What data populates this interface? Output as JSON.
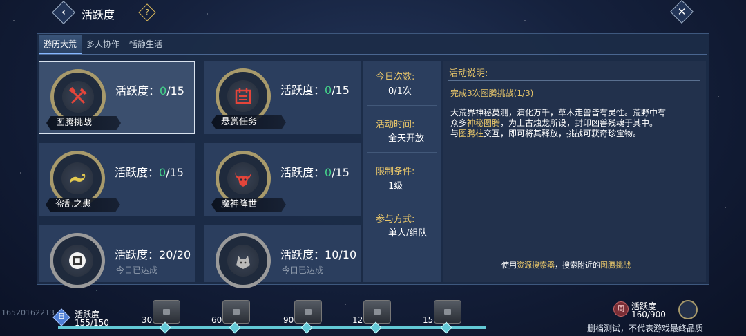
{
  "header": {
    "title": "活跃度",
    "help_icon_text": "?",
    "back_icon": "chevron-left-icon",
    "close_icon": "close-icon"
  },
  "tabs": [
    {
      "label": "游历大荒",
      "active": true
    },
    {
      "label": "多人协作",
      "active": false
    },
    {
      "label": "恬静生活",
      "active": false
    }
  ],
  "activity_label": "活跃度：",
  "cards": [
    {
      "name": "图腾挑战",
      "icon": "axe-hammer-icon",
      "current": "0",
      "max": "/15",
      "done": false,
      "note": ""
    },
    {
      "name": "悬赏任务",
      "icon": "calendar-icon",
      "current": "0",
      "max": "/15",
      "done": false,
      "note": ""
    },
    {
      "name": "盗乱之患",
      "icon": "lizard-icon",
      "current": "0",
      "max": "/15",
      "done": false,
      "note": ""
    },
    {
      "name": "魔神降世",
      "icon": "bull-skull-icon",
      "current": "0",
      "max": "/15",
      "done": false,
      "note": ""
    },
    {
      "name": "",
      "icon": "coin-icon",
      "current": "20",
      "max": "/20",
      "done": true,
      "note": "今日已达成"
    },
    {
      "name": "",
      "icon": "wolf-icon",
      "current": "10",
      "max": "/10",
      "done": true,
      "note": "今日已达成"
    }
  ],
  "info": {
    "today_count_label": "今日次数:",
    "today_count": "0/1次",
    "time_label": "活动时间:",
    "time": "全天开放",
    "limit_label": "限制条件:",
    "limit": "1级",
    "mode_label": "参与方式:",
    "mode": "单人/组队"
  },
  "description": {
    "title": "活动说明:",
    "task": "完成3次图腾挑战(1/3)",
    "line1": "大荒界神秘莫测，演化万千，草木走兽皆有灵性。荒野中有",
    "line2_a": "众多",
    "line2_hl": "神秘图腾",
    "line2_b": "，为上古烛龙所设，封印凶兽残魂于其中。",
    "line3_a": "与",
    "line3_hl": "图腾柱",
    "line3_b": "交互，即可将其释放，挑战可获奇珍宝物。",
    "foot_a": "使用",
    "foot_hl1": "资源搜索器",
    "foot_b": "，搜索附近的",
    "foot_hl2": "图腾挑战"
  },
  "bottom": {
    "uid": "16520162213",
    "day_badge": "日",
    "daily_label": "活跃度",
    "daily_count": "155/150",
    "daily_progress": 1.0,
    "milestones": [
      "30",
      "60",
      "90",
      "120",
      "150"
    ],
    "week_badge": "周",
    "weekly_label": "活跃度",
    "weekly_count": "160/900",
    "disclaimer": "删档测试，不代表游戏最终品质"
  },
  "colors": {
    "accent_gold": "#e8c66a",
    "progress_green": "#44d48a",
    "progress_bar": "#63c9d6"
  }
}
